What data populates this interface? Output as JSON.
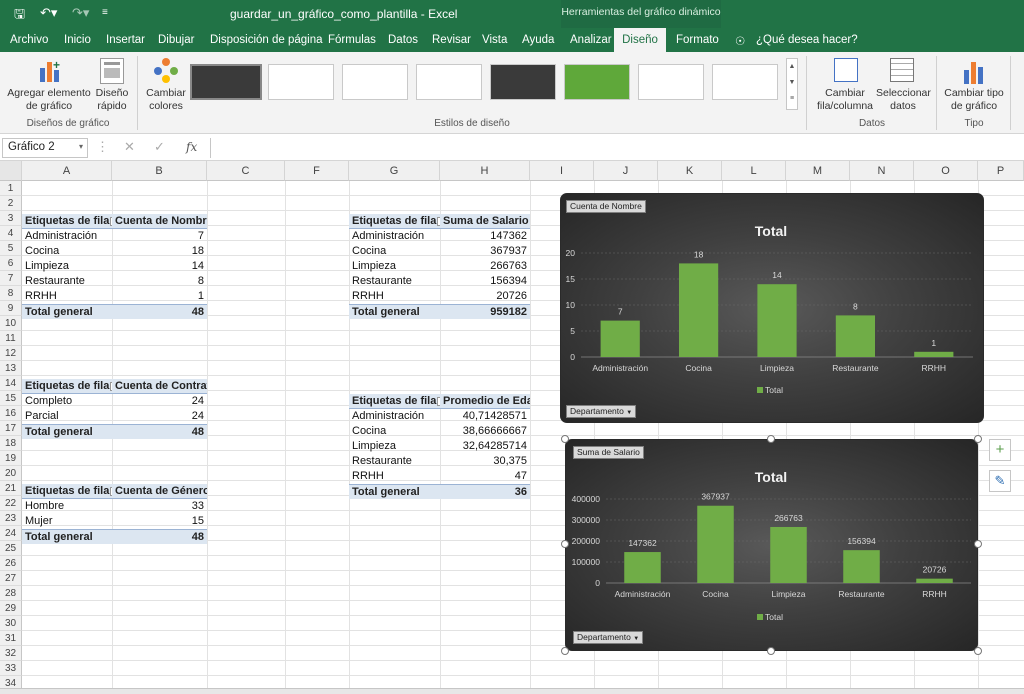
{
  "window": {
    "title": "guardar_un_gráfico_como_plantilla  -  Excel",
    "context_header": "Herramientas del gráfico dinámico"
  },
  "tabs": [
    "Archivo",
    "Inicio",
    "Insertar",
    "Dibujar",
    "Disposición de página",
    "Fórmulas",
    "Datos",
    "Revisar",
    "Vista",
    "Ayuda",
    "Analizar",
    "Diseño",
    "Formato"
  ],
  "tell_me": "¿Qué desea hacer?",
  "ribbon": {
    "add_element": "Agregar elemento de gráfico",
    "quick_layout": "Diseño rápido",
    "change_colors": "Cambiar colores",
    "switch_rowcol": "Cambiar fila/columna",
    "select_data": "Seleccionar datos",
    "change_type": "Cambiar tipo de gráfico",
    "group_layouts": "Diseños de gráfico",
    "group_styles": "Estilos de diseño",
    "group_data": "Datos",
    "group_type": "Tipo"
  },
  "formula_bar": {
    "name_box": "Gráfico 2",
    "fx": "fx"
  },
  "columns": [
    "A",
    "B",
    "C",
    "F",
    "G",
    "H",
    "I",
    "J",
    "K",
    "L",
    "M",
    "N",
    "O",
    "P"
  ],
  "pivot1": {
    "hdr_a": "Etiquetas de fila",
    "hdr_b": "Cuenta de Nombre",
    "rows": [
      [
        "Administración",
        "7"
      ],
      [
        "Cocina",
        "18"
      ],
      [
        "Limpieza",
        "14"
      ],
      [
        "Restaurante",
        "8"
      ],
      [
        "RRHH",
        "1"
      ]
    ],
    "total_label": "Total general",
    "total": "48"
  },
  "pivot2": {
    "hdr_a": "Etiquetas de fila",
    "hdr_b": "Cuenta de Contrato",
    "rows": [
      [
        "Completo",
        "24"
      ],
      [
        "Parcial",
        "24"
      ]
    ],
    "total_label": "Total general",
    "total": "48"
  },
  "pivot3": {
    "hdr_a": "Etiquetas de fila",
    "hdr_b": "Cuenta de Género",
    "rows": [
      [
        "Hombre",
        "33"
      ],
      [
        "Mujer",
        "15"
      ]
    ],
    "total_label": "Total general",
    "total": "48"
  },
  "pivot4": {
    "hdr_a": "Etiquetas de fila",
    "hdr_b": "Suma de Salario",
    "rows": [
      [
        "Administración",
        "147362"
      ],
      [
        "Cocina",
        "367937"
      ],
      [
        "Limpieza",
        "266763"
      ],
      [
        "Restaurante",
        "156394"
      ],
      [
        "RRHH",
        "20726"
      ]
    ],
    "total_label": "Total general",
    "total": "959182"
  },
  "pivot5": {
    "hdr_a": "Etiquetas de fila",
    "hdr_b": "Promedio de Edad",
    "rows": [
      [
        "Administración",
        "40,71428571"
      ],
      [
        "Cocina",
        "38,66666667"
      ],
      [
        "Limpieza",
        "32,64285714"
      ],
      [
        "Restaurante",
        "30,375"
      ],
      [
        "RRHH",
        "47"
      ]
    ],
    "total_label": "Total general",
    "total": "36"
  },
  "chart_data": [
    {
      "type": "bar",
      "title": "Total",
      "field_button": "Cuenta de Nombre",
      "axis_button": "Departamento",
      "legend": "Total",
      "legend_position": "bottom",
      "grid": true,
      "categories": [
        "Administración",
        "Cocina",
        "Limpieza",
        "Restaurante",
        "RRHH"
      ],
      "series": [
        {
          "name": "Total",
          "values": [
            7,
            18,
            14,
            8,
            1
          ]
        }
      ],
      "ylim": [
        0,
        20
      ],
      "yticks": [
        "0",
        "5",
        "10",
        "15",
        "20"
      ],
      "bar_color": "#70ad47"
    },
    {
      "type": "bar",
      "title": "Total",
      "field_button": "Suma de Salario",
      "axis_button": "Departamento",
      "legend": "Total",
      "legend_position": "bottom",
      "grid": true,
      "categories": [
        "Administración",
        "Cocina",
        "Limpieza",
        "Restaurante",
        "RRHH"
      ],
      "series": [
        {
          "name": "Total",
          "values": [
            147362,
            367937,
            266763,
            156394,
            20726
          ]
        }
      ],
      "ylim": [
        0,
        400000
      ],
      "yticks": [
        "0",
        "100000",
        "200000",
        "300000",
        "400000"
      ],
      "bar_color": "#70ad47"
    }
  ],
  "colors": {
    "excel_green": "#217346",
    "pivot_header": "#dce6f1",
    "bar": "#70ad47"
  },
  "icons": {
    "save": "save-icon",
    "undo": "undo-icon",
    "redo": "redo-icon",
    "tell_me": "lightbulb-icon",
    "plus": "plus-icon",
    "brush": "brush-icon"
  }
}
